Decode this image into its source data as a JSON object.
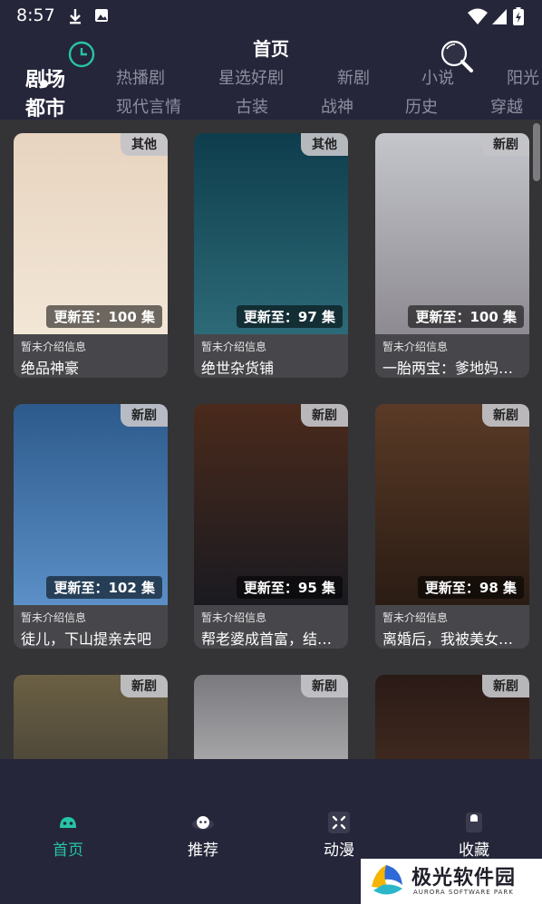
{
  "status_bar": {
    "time": "8:57",
    "icons": [
      "download-icon",
      "photo-icon",
      "wifi-icon",
      "signal-icon",
      "battery-charging-icon"
    ]
  },
  "header": {
    "title": "首页",
    "history_icon": "clock-icon",
    "search_icon": "search-icon",
    "categories_row1": [
      "剧场",
      "热播剧",
      "星选好剧",
      "新剧",
      "小说",
      "阳光"
    ],
    "categories_row2": [
      "都市",
      "现代言情",
      "古装",
      "战神",
      "历史",
      "穿越"
    ],
    "active_tab": "剧场"
  },
  "cards": [
    {
      "badge": "其他",
      "update": "更新至：100 集",
      "info": "暂未介绍信息",
      "title": "绝品神豪",
      "cover_top": "#e8d4c0",
      "cover_bottom": "#f2e6d6"
    },
    {
      "badge": "其他",
      "update": "更新至：97 集",
      "info": "暂未介绍信息",
      "title": "绝世杂货铺",
      "cover_top": "#0e3d4c",
      "cover_bottom": "#2d6a78"
    },
    {
      "badge": "新剧",
      "update": "更新至：100 集",
      "info": "暂未介绍信息",
      "title": "一胎两宝：爹地妈咪快宠我",
      "cover_top": "#c4c6cc",
      "cover_bottom": "#8e8a92"
    },
    {
      "badge": "新剧",
      "update": "更新至：102 集",
      "info": "暂未介绍信息",
      "title": "徒儿，下山提亲去吧",
      "cover_top": "#2d5a8c",
      "cover_bottom": "#5b8fc6"
    },
    {
      "badge": "新剧",
      "update": "更新至：95 集",
      "info": "暂未介绍信息",
      "title": "帮老婆成首富，结果她要离婚",
      "cover_top": "#4a2a1c",
      "cover_bottom": "#1a1a20"
    },
    {
      "badge": "新剧",
      "update": "更新至：98 集",
      "info": "暂未介绍信息",
      "title": "离婚后，我被美女包围了",
      "cover_top": "#5a3a26",
      "cover_bottom": "#2a1c14"
    },
    {
      "badge": "新剧",
      "update": "",
      "info": "",
      "title": "",
      "cover_top": "#6b6044",
      "cover_bottom": "#2a2a2c"
    },
    {
      "badge": "新剧",
      "update": "",
      "info": "",
      "title": "",
      "cover_top": "#7a7a7e",
      "cover_bottom": "#e0e0e2"
    },
    {
      "badge": "新剧",
      "update": "",
      "info": "",
      "title": "",
      "cover_top": "#2a1a16",
      "cover_bottom": "#5a3c2a"
    }
  ],
  "bottom_nav": [
    {
      "label": "首页",
      "icon": "home-icon",
      "active": true
    },
    {
      "label": "推荐",
      "icon": "recommend-icon",
      "active": false
    },
    {
      "label": "动漫",
      "icon": "anime-icon",
      "active": false
    },
    {
      "label": "收藏",
      "icon": "favorite-icon",
      "active": false
    }
  ],
  "watermark": {
    "main": "极光软件园",
    "sub": "AURORA SOFTWARE PARK",
    "icon": "aurora-logo-icon"
  },
  "colors": {
    "accent": "#26c4a8",
    "header_bg": "#25263a",
    "grid_bg": "#343436",
    "card_bg": "#47474b"
  }
}
